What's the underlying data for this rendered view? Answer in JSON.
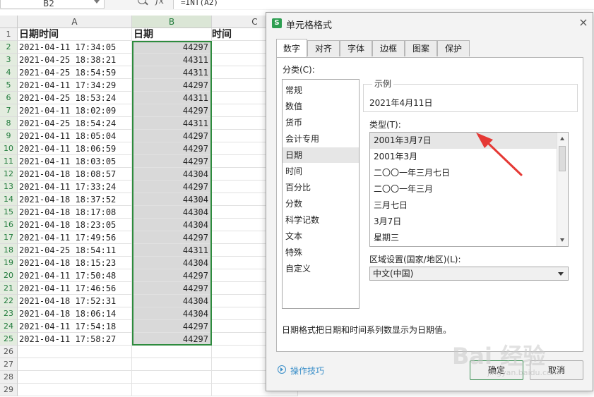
{
  "formula_bar": {
    "name_box": "B2",
    "fx_label": "fx",
    "formula": "=INT(A2)"
  },
  "sheet": {
    "columns": [
      "A",
      "B",
      "C"
    ],
    "header_row": {
      "a": "日期时间",
      "b": "日期",
      "c": "时间"
    },
    "row_numbers": [
      "1",
      "2",
      "3",
      "4",
      "5",
      "6",
      "7",
      "8",
      "9",
      "10",
      "11",
      "12",
      "13",
      "14",
      "15",
      "16",
      "17",
      "18",
      "19",
      "20",
      "21",
      "22",
      "23",
      "24",
      "25",
      "26",
      "27",
      "28",
      "29"
    ],
    "rows": [
      {
        "a": "2021-04-11 17:34:05",
        "b": "44297"
      },
      {
        "a": "2021-04-25 18:38:21",
        "b": "44311"
      },
      {
        "a": "2021-04-25 18:54:59",
        "b": "44311"
      },
      {
        "a": "2021-04-11 17:34:29",
        "b": "44297"
      },
      {
        "a": "2021-04-25 18:53:24",
        "b": "44311"
      },
      {
        "a": "2021-04-11 18:02:09",
        "b": "44297"
      },
      {
        "a": "2021-04-25 18:54:24",
        "b": "44311"
      },
      {
        "a": "2021-04-11 18:05:04",
        "b": "44297"
      },
      {
        "a": "2021-04-11 18:06:59",
        "b": "44297"
      },
      {
        "a": "2021-04-11 18:03:05",
        "b": "44297"
      },
      {
        "a": "2021-04-18 18:08:57",
        "b": "44304"
      },
      {
        "a": "2021-04-11 17:33:24",
        "b": "44297"
      },
      {
        "a": "2021-04-18 18:37:52",
        "b": "44304"
      },
      {
        "a": "2021-04-18 18:17:08",
        "b": "44304"
      },
      {
        "a": "2021-04-18 18:23:05",
        "b": "44304"
      },
      {
        "a": "2021-04-11 17:49:56",
        "b": "44297"
      },
      {
        "a": "2021-04-25 18:54:11",
        "b": "44311"
      },
      {
        "a": "2021-04-18 18:15:23",
        "b": "44304"
      },
      {
        "a": "2021-04-11 17:50:48",
        "b": "44297"
      },
      {
        "a": "2021-04-11 17:46:56",
        "b": "44297"
      },
      {
        "a": "2021-04-18 17:52:31",
        "b": "44304"
      },
      {
        "a": "2021-04-18 18:06:14",
        "b": "44304"
      },
      {
        "a": "2021-04-11 17:54:18",
        "b": "44297"
      },
      {
        "a": "2021-04-11 17:58:27",
        "b": "44297"
      }
    ],
    "selection_color": "#2e8b3e"
  },
  "dialog": {
    "title": "单元格格式",
    "logo": "S",
    "close": "×",
    "tabs": [
      "数字",
      "对齐",
      "字体",
      "边框",
      "图案",
      "保护"
    ],
    "active_tab": "数字",
    "category_label": "分类(C):",
    "categories": [
      "常规",
      "数值",
      "货币",
      "会计专用",
      "日期",
      "时间",
      "百分比",
      "分数",
      "科学记数",
      "文本",
      "特殊",
      "自定义"
    ],
    "selected_category": "日期",
    "sample_label": "示例",
    "sample_value": "2021年4月11日",
    "type_label": "类型(T):",
    "types": [
      "2001年3月7日",
      "2001年3月",
      "二〇〇一年三月七日",
      "二〇〇一年三月",
      "三月七日",
      "3月7日",
      "星期三"
    ],
    "selected_type": "2001年3月7日",
    "locale_label": "区域设置(国家/地区)(L):",
    "locale_value": "中文(中国)",
    "description": "日期格式把日期和时间系列数显示为日期值。",
    "tips_link": "操作技巧",
    "ok_label": "确定",
    "cancel_label": "取消"
  },
  "watermark": {
    "text": "Bai 经验",
    "sub": "jingyan.baidu.com"
  },
  "colors": {
    "accent_green": "#2d9e51",
    "link_blue": "#3b8fc9",
    "annotation_red": "#e53935"
  }
}
